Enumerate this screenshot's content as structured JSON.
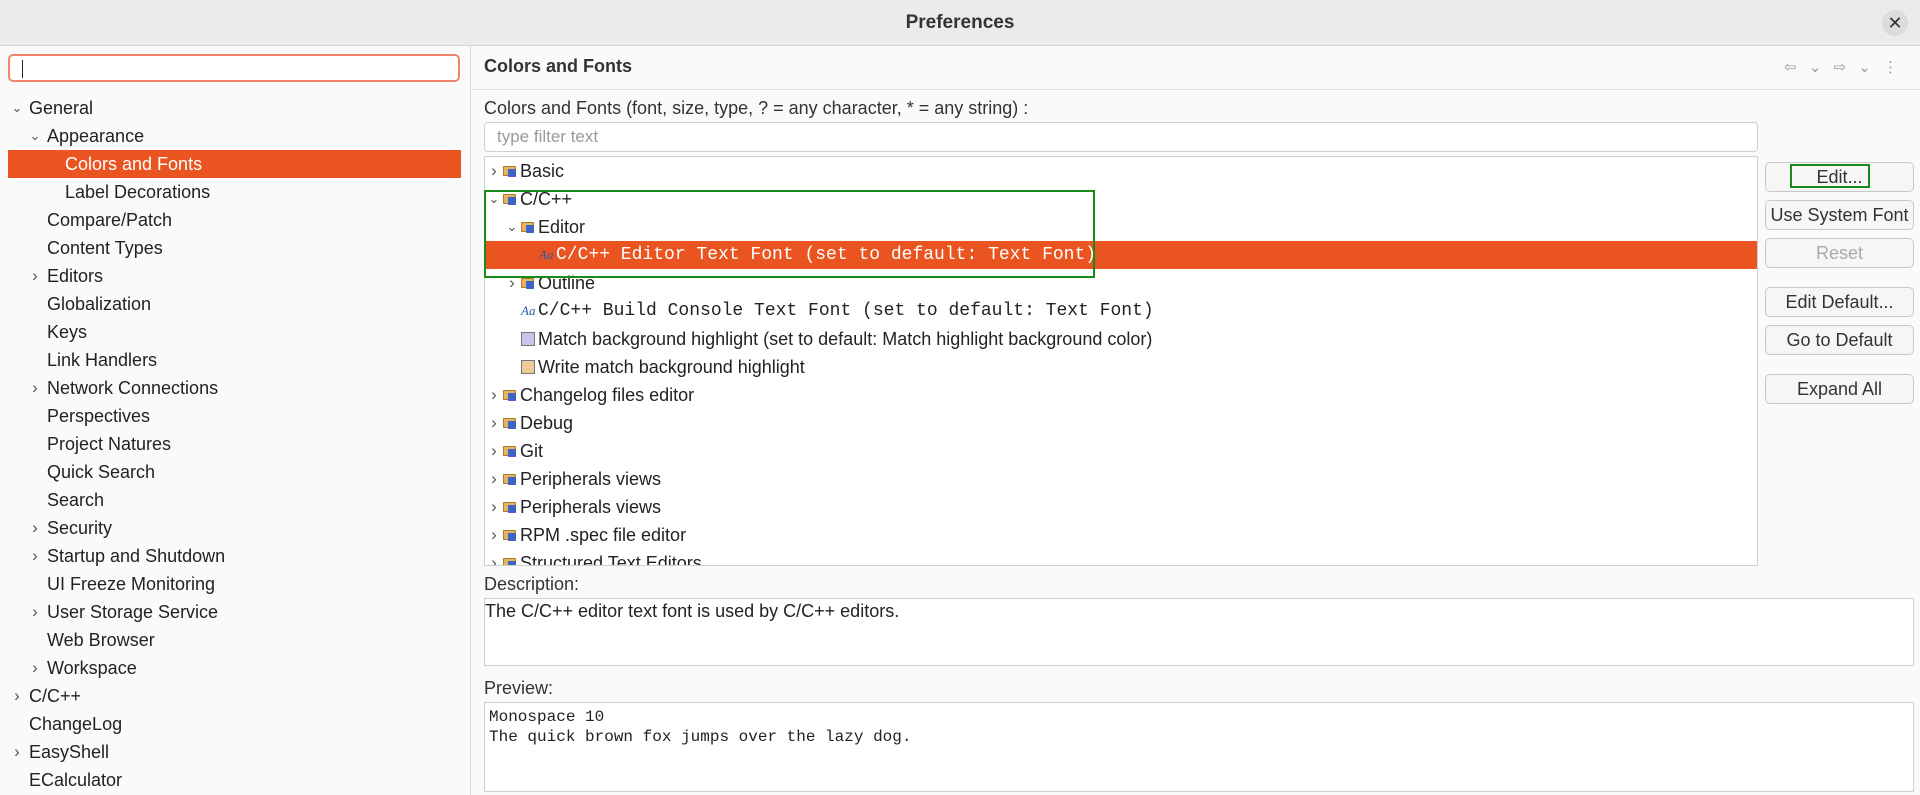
{
  "window": {
    "title": "Preferences",
    "close_glyph": "✕"
  },
  "search": {
    "value": "",
    "placeholder": ""
  },
  "nav": [
    {
      "label": "General",
      "depth": 0,
      "expander": "open"
    },
    {
      "label": "Appearance",
      "depth": 1,
      "expander": "open"
    },
    {
      "label": "Colors and Fonts",
      "depth": 2,
      "expander": "none",
      "selected": true
    },
    {
      "label": "Label Decorations",
      "depth": 2,
      "expander": "none"
    },
    {
      "label": "Compare/Patch",
      "depth": 1,
      "expander": "none"
    },
    {
      "label": "Content Types",
      "depth": 1,
      "expander": "none"
    },
    {
      "label": "Editors",
      "depth": 1,
      "expander": "closed"
    },
    {
      "label": "Globalization",
      "depth": 1,
      "expander": "none"
    },
    {
      "label": "Keys",
      "depth": 1,
      "expander": "none"
    },
    {
      "label": "Link Handlers",
      "depth": 1,
      "expander": "none"
    },
    {
      "label": "Network Connections",
      "depth": 1,
      "expander": "closed"
    },
    {
      "label": "Perspectives",
      "depth": 1,
      "expander": "none"
    },
    {
      "label": "Project Natures",
      "depth": 1,
      "expander": "none"
    },
    {
      "label": "Quick Search",
      "depth": 1,
      "expander": "none"
    },
    {
      "label": "Search",
      "depth": 1,
      "expander": "none"
    },
    {
      "label": "Security",
      "depth": 1,
      "expander": "closed"
    },
    {
      "label": "Startup and Shutdown",
      "depth": 1,
      "expander": "closed"
    },
    {
      "label": "UI Freeze Monitoring",
      "depth": 1,
      "expander": "none"
    },
    {
      "label": "User Storage Service",
      "depth": 1,
      "expander": "closed"
    },
    {
      "label": "Web Browser",
      "depth": 1,
      "expander": "none"
    },
    {
      "label": "Workspace",
      "depth": 1,
      "expander": "closed"
    },
    {
      "label": "C/C++",
      "depth": 0,
      "expander": "closed"
    },
    {
      "label": "ChangeLog",
      "depth": 0,
      "expander": "none"
    },
    {
      "label": "EasyShell",
      "depth": 0,
      "expander": "closed"
    },
    {
      "label": "ECalculator",
      "depth": 0,
      "expander": "none"
    }
  ],
  "page": {
    "title": "Colors and Fonts",
    "header_icons": "⇦ ⌄ ⇨ ⌄ ⋮",
    "tree_label": "Colors and Fonts (font, size, type, ? = any character, * = any string) :",
    "filter_placeholder": "type filter text",
    "description_label": "Description:",
    "description_text": "The C/C++ editor text font is used by C/C++ editors.",
    "preview_label": "Preview:",
    "preview_line1": "Monospace 10",
    "preview_line2": "The quick brown fox jumps over the lazy dog."
  },
  "tree": [
    {
      "label": "Basic",
      "depth": 0,
      "expander": "closed",
      "icon": "folder-icon"
    },
    {
      "label": "C/C++",
      "depth": 0,
      "expander": "open",
      "icon": "folder-icon"
    },
    {
      "label": "Editor",
      "depth": 1,
      "expander": "open",
      "icon": "folder-icon"
    },
    {
      "label": "C/C++ Editor Text Font (set to default: Text Font)",
      "depth": 2,
      "expander": "none",
      "icon": "font-icon",
      "mono": true,
      "selected": true
    },
    {
      "label": "Outline",
      "depth": 1,
      "expander": "closed",
      "icon": "folder-icon"
    },
    {
      "label": "C/C++ Build Console Text Font (set to default: Text Font)",
      "depth": 1,
      "expander": "none",
      "icon": "font-icon",
      "mono": true
    },
    {
      "label": "Match background highlight (set to default: Match highlight background color)",
      "depth": 1,
      "expander": "none",
      "icon": "color-swatch-icon",
      "color": "#c9c6ec"
    },
    {
      "label": "Write match background highlight",
      "depth": 1,
      "expander": "none",
      "icon": "color-swatch-icon",
      "color": "#f0c89a"
    },
    {
      "label": "Changelog files editor",
      "depth": 0,
      "expander": "closed",
      "icon": "folder-icon"
    },
    {
      "label": "Debug",
      "depth": 0,
      "expander": "closed",
      "icon": "folder-icon"
    },
    {
      "label": "Git",
      "depth": 0,
      "expander": "closed",
      "icon": "folder-icon"
    },
    {
      "label": "Peripherals views",
      "depth": 0,
      "expander": "closed",
      "icon": "folder-icon"
    },
    {
      "label": "Peripherals views",
      "depth": 0,
      "expander": "closed",
      "icon": "folder-icon"
    },
    {
      "label": "RPM .spec file editor",
      "depth": 0,
      "expander": "closed",
      "icon": "folder-icon"
    },
    {
      "label": "Structured Text Editors",
      "depth": 0,
      "expander": "closed",
      "icon": "folder-icon"
    }
  ],
  "buttons": {
    "edit": "Edit...",
    "use_system_font": "Use System Font",
    "reset": "Reset",
    "edit_default": "Edit Default...",
    "go_to_default": "Go to Default",
    "expand_all": "Expand All"
  },
  "colors": {
    "accent": "#e95420",
    "highlight_box": "#1a8a1a",
    "search_border": "#f0856c"
  }
}
